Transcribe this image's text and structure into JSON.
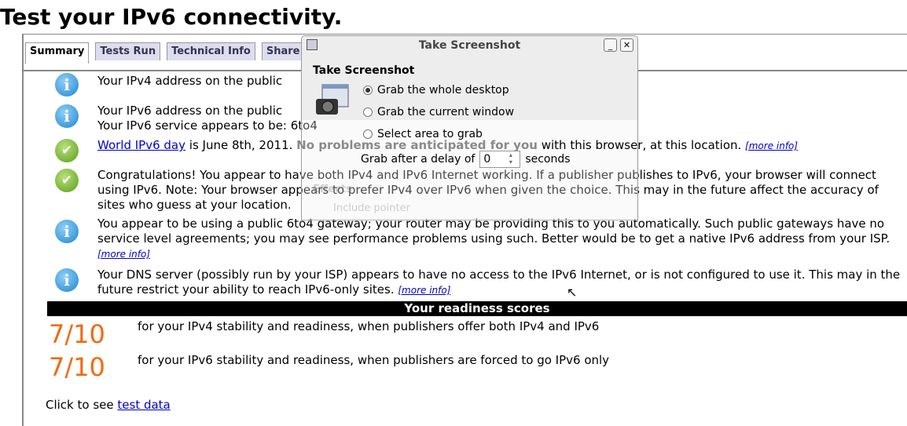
{
  "page": {
    "title": "Test your IPv6 connectivity."
  },
  "tabs": [
    {
      "label": "Summary"
    },
    {
      "label": "Tests Run"
    },
    {
      "label": "Technical Info"
    },
    {
      "label": "Share R"
    }
  ],
  "results": [
    {
      "icon": "info-icon",
      "text": "Your IPv4 address on the public"
    },
    {
      "icon": "info-icon",
      "line1": "Your IPv6 address on the public",
      "line2": "Your IPv6 service appears to be: ",
      "value": "6to4"
    },
    {
      "icon": "check-icon",
      "link": "World IPv6 day",
      "text": " is June 8th, 2011. ",
      "bold": "No problems are anticipated for you",
      "tail": " with this browser, at this location. ",
      "more": "[more info]"
    },
    {
      "icon": "check-icon",
      "text": "Congratulations! You appear to have both IPv4 and IPv6 Internet working. If a publisher publishes to IPv6, your browser will connect using IPv6. Note: Your browser appears to prefer IPv4 over IPv6 when given the choice. This may in the future affect the accuracy of sites who guess at your location."
    },
    {
      "icon": "info-icon",
      "text": "You appear to be using a public 6to4 gateway; your router may be providing this to you automatically. Such public gateways have no service level agreements; you may see performance problems using such. Better would be to get a native IPv6 address from your ISP. ",
      "more": "[more info]"
    },
    {
      "icon": "info-icon",
      "text": "Your DNS server (possibly run by your ISP) appears to have no access to the IPv6 Internet, or is not configured to use it. This may in the future restrict your ability to reach IPv6-only sites. ",
      "more": "[more info]"
    }
  ],
  "readiness": {
    "heading": "Your readiness scores",
    "scores": [
      {
        "score": "7/10",
        "text": "for your IPv4 stability and readiness, when publishers offer both IPv4 and IPv6"
      },
      {
        "score": "7/10",
        "text": "for your IPv6 stability and readiness, when publishers are forced to go IPv6 only"
      }
    ]
  },
  "footer": {
    "text": "Click to see ",
    "link": "test data"
  },
  "dialog": {
    "title": "Take Screenshot",
    "heading": "Take Screenshot",
    "options": [
      {
        "label": "Grab the whole desktop",
        "selected": true
      },
      {
        "label": "Grab the current window",
        "selected": false
      },
      {
        "label": "Select area to grab",
        "selected": false
      }
    ],
    "delay_label": "Grab after a delay of",
    "delay_value": "0",
    "delay_unit": "seconds",
    "effects_label": "Effects",
    "include_pointer": "Include pointer"
  },
  "colors": {
    "score": "#f26a10",
    "link": "#0000cc"
  }
}
